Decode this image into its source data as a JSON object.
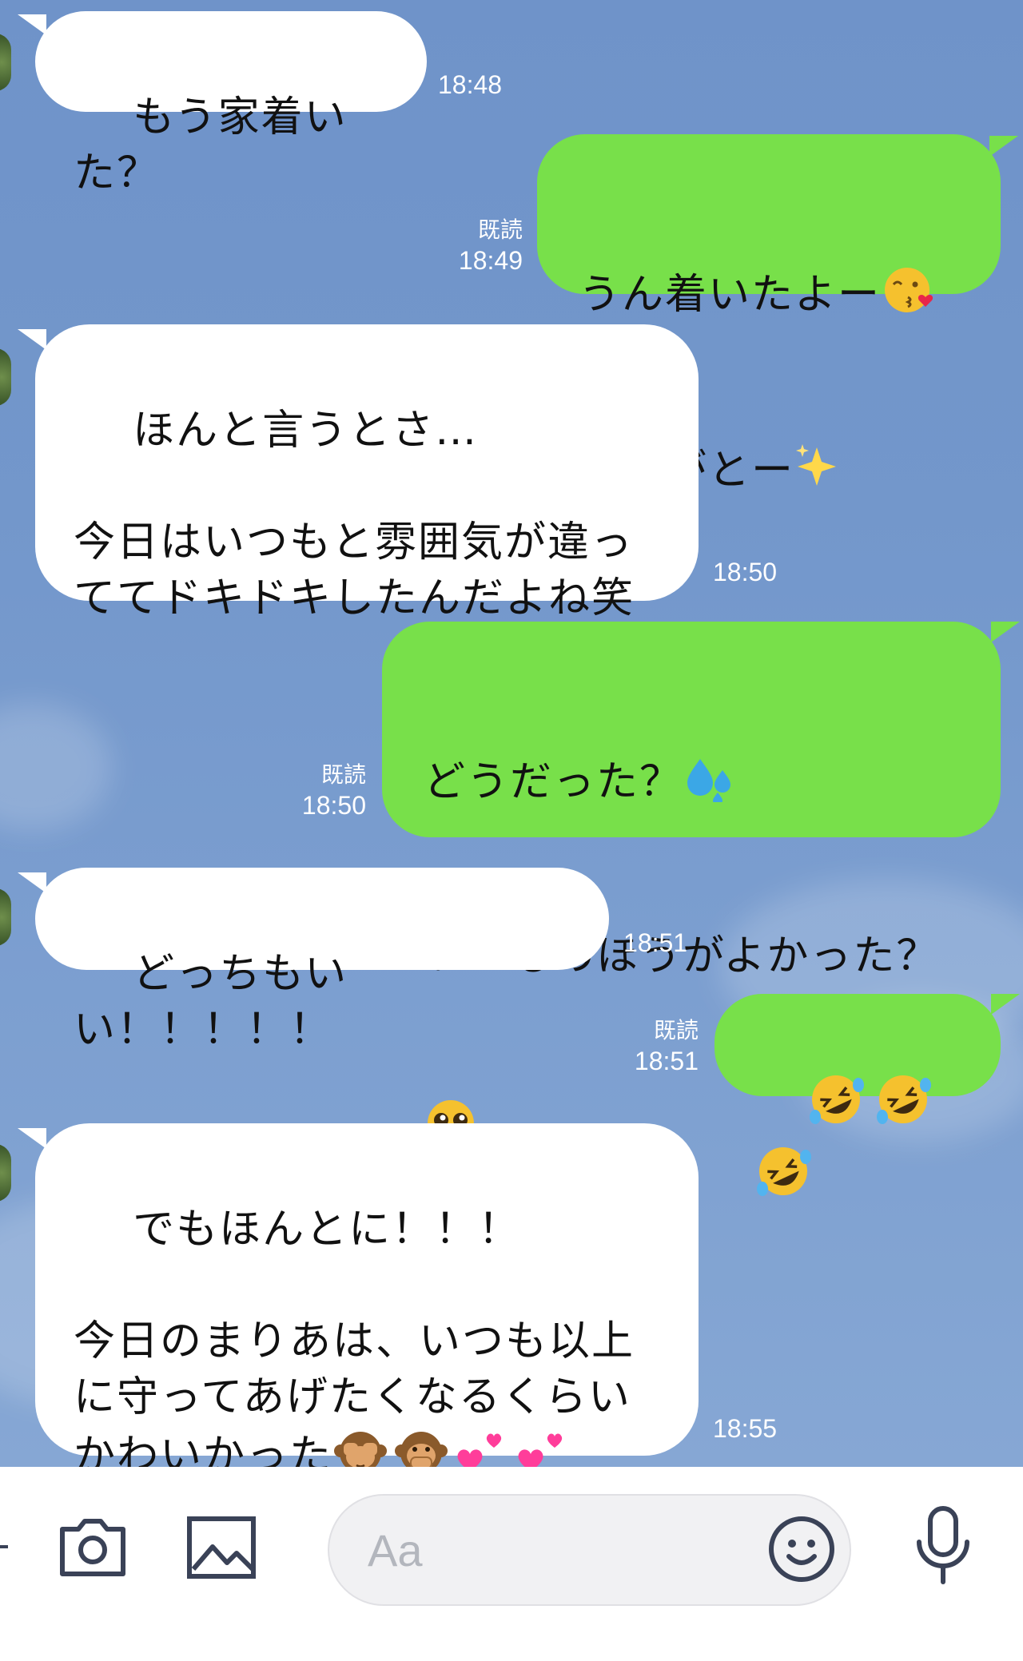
{
  "messages": [
    {
      "dir": "in",
      "text": "もう家着いた？",
      "time": "18:48"
    },
    {
      "dir": "out",
      "text": "うん着いたよー",
      "text2": "ありがとー",
      "read": "既読",
      "time": "18:49",
      "emoji1": "kiss-heart-emoji",
      "emoji2": "sparkles-emoji"
    },
    {
      "dir": "in",
      "text": "ほんと言うとさ…\n\n今日はいつもと雰囲気が違っ\nててドキドキしたんだよね笑",
      "time": "18:50"
    },
    {
      "dir": "out",
      "text": "どうだった？",
      "text2": "いつものほうがよかった？",
      "read": "既読",
      "time": "18:50",
      "emoji1": "sweat-droplets-emoji",
      "emoji2": "pleading-face-emoji"
    },
    {
      "dir": "in",
      "text": "どっちもいい！！！！！",
      "time": "18:51"
    },
    {
      "dir": "out",
      "read": "既読",
      "time": "18:51",
      "emoji1": "rolling-laughing-emoji"
    },
    {
      "dir": "in",
      "text": "でもほんとに！！！\n\n今日のまりあは、いつも以上\nに守ってあげたくなるくらい\nかわいかった",
      "time": "18:55",
      "emoji1": "see-no-evil-monkey-emoji",
      "emoji2": "speak-no-evil-monkey-emoji",
      "emoji3": "two-hearts-emoji"
    }
  ],
  "input": {
    "placeholder": "Aa"
  },
  "toolbar": {
    "icons": [
      "camera-icon",
      "image-icon",
      "smile-icon",
      "microphone-icon"
    ]
  },
  "colors": {
    "background": "#7397cb",
    "outgoing": "#78e04a",
    "incoming": "#ffffff"
  }
}
